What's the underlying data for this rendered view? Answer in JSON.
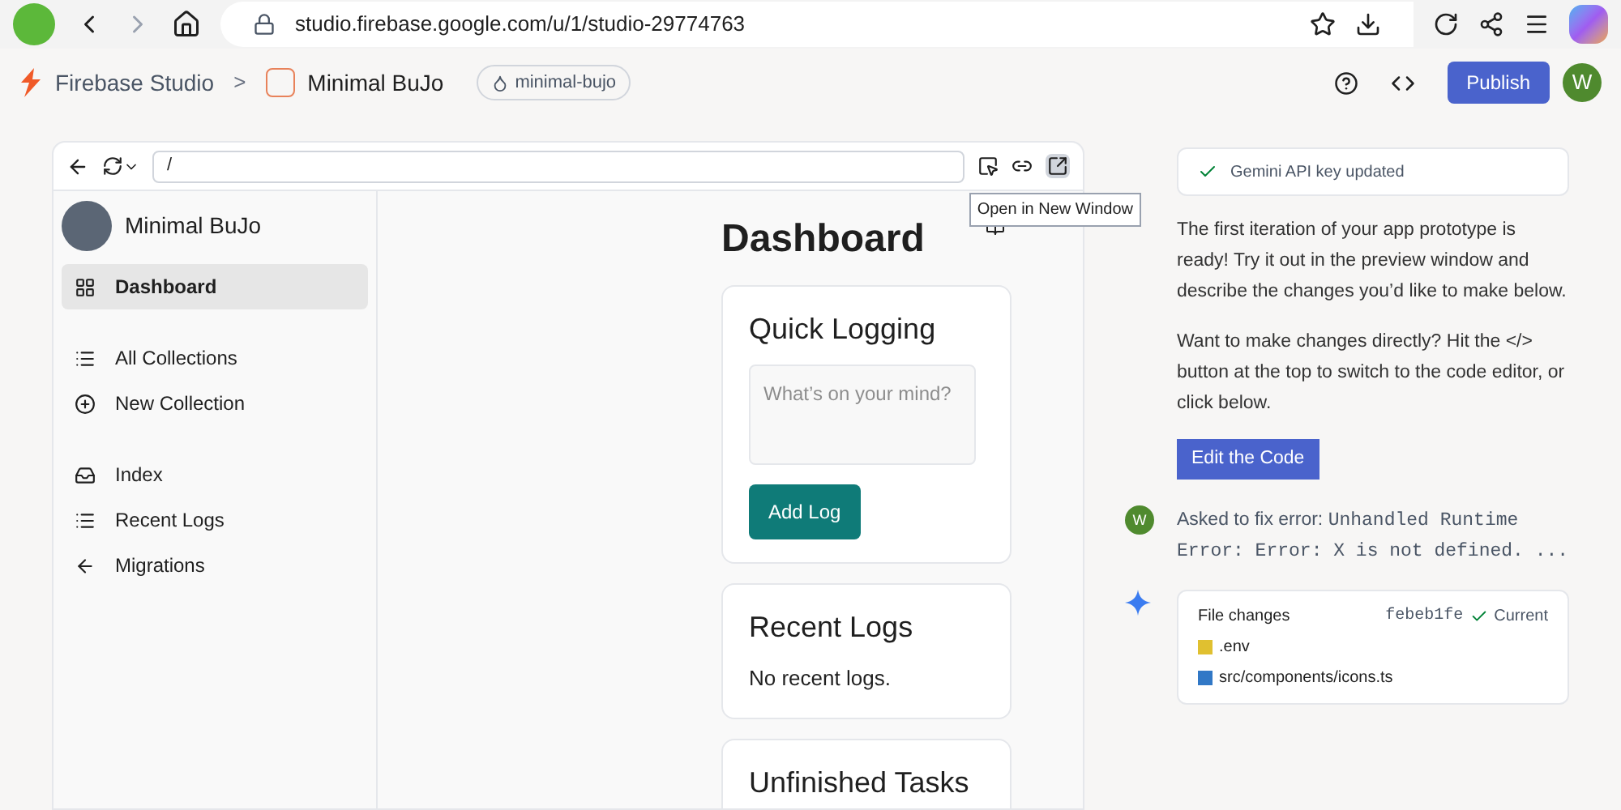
{
  "browser": {
    "url": "studio.firebase.google.com/u/1/studio-29774763"
  },
  "header": {
    "brand": "Firebase Studio",
    "separator": ">",
    "project": "Minimal BuJo",
    "workspace": "minimal-bujo",
    "publish": "Publish",
    "avatar": "W"
  },
  "preview": {
    "path": "/",
    "tooltip": "Open in New Window",
    "sidebar": {
      "title": "Minimal BuJo",
      "sections": [
        {
          "items": [
            {
              "kind": "grid",
              "label": "Dashboard",
              "selected": true
            }
          ]
        },
        {
          "items": [
            {
              "kind": "list",
              "label": "All Collections",
              "selected": false
            },
            {
              "kind": "plus",
              "label": "New Collection",
              "selected": false
            }
          ]
        },
        {
          "items": [
            {
              "kind": "inbox",
              "label": "Index",
              "selected": false
            },
            {
              "kind": "dots",
              "label": "Recent Logs",
              "selected": false
            },
            {
              "kind": "back",
              "label": "Migrations",
              "selected": false
            }
          ]
        }
      ]
    },
    "title": "Dashboard",
    "cards": [
      {
        "kind": "form",
        "title": "Quick Logging",
        "placeholder": "What’s on your mind?",
        "button": "Add Log"
      },
      {
        "kind": "text",
        "title": "Recent Logs",
        "body": "No recent logs."
      },
      {
        "kind": "text",
        "title": "Unfinished Tasks"
      }
    ]
  },
  "chat": {
    "notice": "Gemini API key updated",
    "paragraphs": [
      "The first iteration of your app prototype is ready! Try it out in the preview window and describe the changes you’d like to make below.",
      "Want to make changes directly? Hit the </> button at the top to switch to the code editor, or click below."
    ],
    "edit_button": "Edit the Code",
    "user": {
      "avatar": "W",
      "prefix": "Asked to fix error:",
      "code": "Unhandled Runtime Error: Error: X is not defined. ..."
    },
    "changes": {
      "title": "File changes",
      "commit": "febeb1fe",
      "status": "Current",
      "files": [
        {
          "kind": "env",
          "name": ".env"
        },
        {
          "kind": "ts",
          "name": "src/components/icons.ts"
        }
      ]
    }
  }
}
